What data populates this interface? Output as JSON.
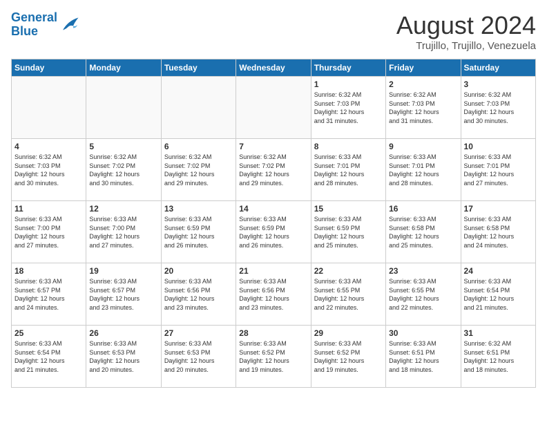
{
  "header": {
    "logo_line1": "General",
    "logo_line2": "Blue",
    "month": "August 2024",
    "location": "Trujillo, Trujillo, Venezuela"
  },
  "weekdays": [
    "Sunday",
    "Monday",
    "Tuesday",
    "Wednesday",
    "Thursday",
    "Friday",
    "Saturday"
  ],
  "weeks": [
    [
      {
        "day": "",
        "info": ""
      },
      {
        "day": "",
        "info": ""
      },
      {
        "day": "",
        "info": ""
      },
      {
        "day": "",
        "info": ""
      },
      {
        "day": "1",
        "info": "Sunrise: 6:32 AM\nSunset: 7:03 PM\nDaylight: 12 hours\nand 31 minutes."
      },
      {
        "day": "2",
        "info": "Sunrise: 6:32 AM\nSunset: 7:03 PM\nDaylight: 12 hours\nand 31 minutes."
      },
      {
        "day": "3",
        "info": "Sunrise: 6:32 AM\nSunset: 7:03 PM\nDaylight: 12 hours\nand 30 minutes."
      }
    ],
    [
      {
        "day": "4",
        "info": "Sunrise: 6:32 AM\nSunset: 7:03 PM\nDaylight: 12 hours\nand 30 minutes."
      },
      {
        "day": "5",
        "info": "Sunrise: 6:32 AM\nSunset: 7:02 PM\nDaylight: 12 hours\nand 30 minutes."
      },
      {
        "day": "6",
        "info": "Sunrise: 6:32 AM\nSunset: 7:02 PM\nDaylight: 12 hours\nand 29 minutes."
      },
      {
        "day": "7",
        "info": "Sunrise: 6:32 AM\nSunset: 7:02 PM\nDaylight: 12 hours\nand 29 minutes."
      },
      {
        "day": "8",
        "info": "Sunrise: 6:33 AM\nSunset: 7:01 PM\nDaylight: 12 hours\nand 28 minutes."
      },
      {
        "day": "9",
        "info": "Sunrise: 6:33 AM\nSunset: 7:01 PM\nDaylight: 12 hours\nand 28 minutes."
      },
      {
        "day": "10",
        "info": "Sunrise: 6:33 AM\nSunset: 7:01 PM\nDaylight: 12 hours\nand 27 minutes."
      }
    ],
    [
      {
        "day": "11",
        "info": "Sunrise: 6:33 AM\nSunset: 7:00 PM\nDaylight: 12 hours\nand 27 minutes."
      },
      {
        "day": "12",
        "info": "Sunrise: 6:33 AM\nSunset: 7:00 PM\nDaylight: 12 hours\nand 27 minutes."
      },
      {
        "day": "13",
        "info": "Sunrise: 6:33 AM\nSunset: 6:59 PM\nDaylight: 12 hours\nand 26 minutes."
      },
      {
        "day": "14",
        "info": "Sunrise: 6:33 AM\nSunset: 6:59 PM\nDaylight: 12 hours\nand 26 minutes."
      },
      {
        "day": "15",
        "info": "Sunrise: 6:33 AM\nSunset: 6:59 PM\nDaylight: 12 hours\nand 25 minutes."
      },
      {
        "day": "16",
        "info": "Sunrise: 6:33 AM\nSunset: 6:58 PM\nDaylight: 12 hours\nand 25 minutes."
      },
      {
        "day": "17",
        "info": "Sunrise: 6:33 AM\nSunset: 6:58 PM\nDaylight: 12 hours\nand 24 minutes."
      }
    ],
    [
      {
        "day": "18",
        "info": "Sunrise: 6:33 AM\nSunset: 6:57 PM\nDaylight: 12 hours\nand 24 minutes."
      },
      {
        "day": "19",
        "info": "Sunrise: 6:33 AM\nSunset: 6:57 PM\nDaylight: 12 hours\nand 23 minutes."
      },
      {
        "day": "20",
        "info": "Sunrise: 6:33 AM\nSunset: 6:56 PM\nDaylight: 12 hours\nand 23 minutes."
      },
      {
        "day": "21",
        "info": "Sunrise: 6:33 AM\nSunset: 6:56 PM\nDaylight: 12 hours\nand 23 minutes."
      },
      {
        "day": "22",
        "info": "Sunrise: 6:33 AM\nSunset: 6:55 PM\nDaylight: 12 hours\nand 22 minutes."
      },
      {
        "day": "23",
        "info": "Sunrise: 6:33 AM\nSunset: 6:55 PM\nDaylight: 12 hours\nand 22 minutes."
      },
      {
        "day": "24",
        "info": "Sunrise: 6:33 AM\nSunset: 6:54 PM\nDaylight: 12 hours\nand 21 minutes."
      }
    ],
    [
      {
        "day": "25",
        "info": "Sunrise: 6:33 AM\nSunset: 6:54 PM\nDaylight: 12 hours\nand 21 minutes."
      },
      {
        "day": "26",
        "info": "Sunrise: 6:33 AM\nSunset: 6:53 PM\nDaylight: 12 hours\nand 20 minutes."
      },
      {
        "day": "27",
        "info": "Sunrise: 6:33 AM\nSunset: 6:53 PM\nDaylight: 12 hours\nand 20 minutes."
      },
      {
        "day": "28",
        "info": "Sunrise: 6:33 AM\nSunset: 6:52 PM\nDaylight: 12 hours\nand 19 minutes."
      },
      {
        "day": "29",
        "info": "Sunrise: 6:33 AM\nSunset: 6:52 PM\nDaylight: 12 hours\nand 19 minutes."
      },
      {
        "day": "30",
        "info": "Sunrise: 6:33 AM\nSunset: 6:51 PM\nDaylight: 12 hours\nand 18 minutes."
      },
      {
        "day": "31",
        "info": "Sunrise: 6:32 AM\nSunset: 6:51 PM\nDaylight: 12 hours\nand 18 minutes."
      }
    ]
  ]
}
